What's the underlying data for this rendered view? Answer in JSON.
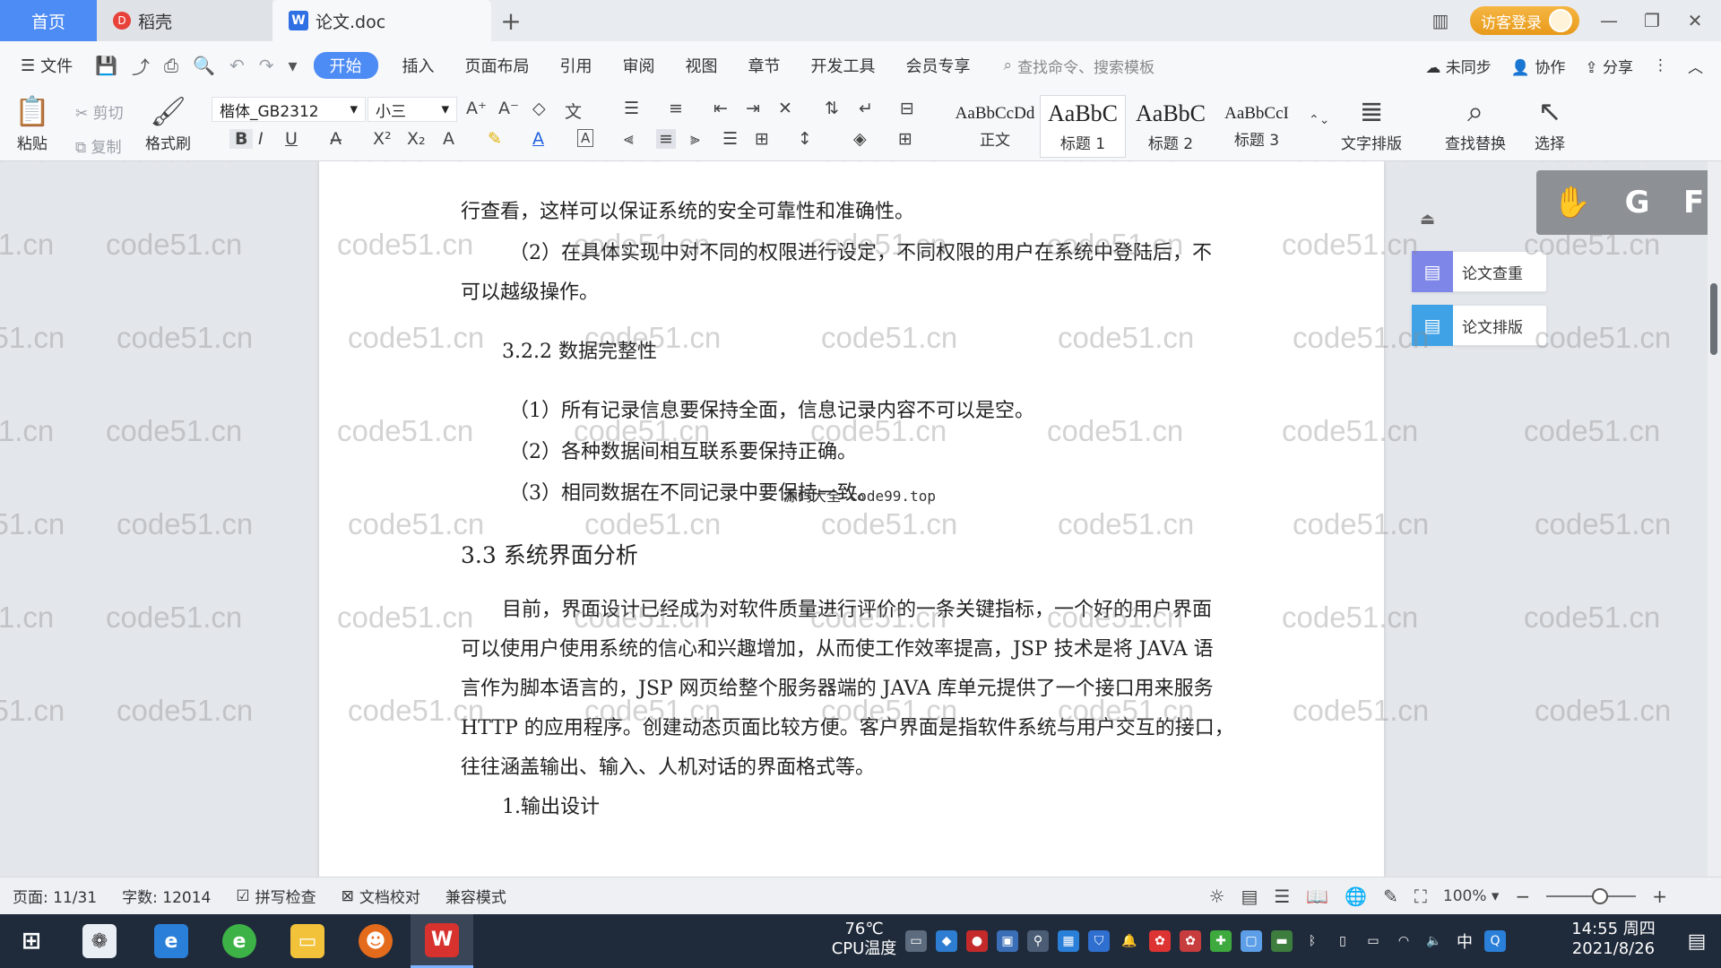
{
  "tabs": {
    "home": "首页",
    "daoke": "稻壳",
    "doc": "论文.doc",
    "plus": "+"
  },
  "titlebar": {
    "visitor_login": "访客登录"
  },
  "menu": {
    "file": "文件",
    "items": [
      "开始",
      "插入",
      "页面布局",
      "引用",
      "审阅",
      "视图",
      "章节",
      "开发工具",
      "会员专享"
    ],
    "search_placeholder": "查找命令、搜索模板",
    "unsynced": "未同步",
    "collaborate": "协作",
    "share": "分享"
  },
  "ribbon": {
    "paste": "粘贴",
    "cut": "剪切",
    "copy": "复制",
    "format_painter": "格式刷",
    "font_name": "楷体_GB2312",
    "font_size": "小三",
    "styles": [
      {
        "sample": "AaBbCcDd",
        "label": "正文"
      },
      {
        "sample": "AaBbC",
        "label": "标题 1"
      },
      {
        "sample": "AaBbC",
        "label": "标题 2"
      },
      {
        "sample": "AaBbCcI",
        "label": "标题 3"
      }
    ],
    "text_layout": "文字排版",
    "find_replace": "查找替换",
    "select": "选择"
  },
  "document": {
    "lines": [
      "行查看，这样可以保证系统的安全可靠性和准确性。",
      "（2）在具体实现中对不同的权限进行设定，不同权限的用户在系统中登陆后，不",
      "可以越级操作。",
      "3.2.2 数据完整性",
      "（1）所有记录信息要保持全面，信息记录内容不可以是空。",
      "（2）各种数据间相互联系要保持正确。",
      "（3）相同数据在不同记录中要保持一致。",
      "3.3 系统界面分析",
      "目前，界面设计已经成为对软件质量进行评价的一条关键指标，一个好的用户界面",
      "可以使用户使用系统的信心和兴趣增加，从而使工作效率提高，JSP 技术是将 JAVA 语",
      "言作为脚本语言的，JSP 网页给整个服务器端的 JAVA 库单元提供了一个接口用来服务",
      "HTTP 的应用程序。创建动态页面比较方便。客户界面是指软件系统与用户交互的接口，",
      "往往涵盖输出、输入、人机对话的界面格式等。",
      "1.输出设计"
    ],
    "overlay": "源码大全 code99.top",
    "watermark": "code51.cn"
  },
  "side_panel": {
    "check": "论文查重",
    "layout": "论文排版",
    "float_letters": [
      "G",
      "F"
    ]
  },
  "status": {
    "page": "页面: 11/31",
    "word_count": "字数: 12014",
    "spell_check": "拼写检查",
    "doc_proofread": "文档校对",
    "compat_mode": "兼容模式",
    "zoom": "100%",
    "zoom_level": 0.6
  },
  "taskbar": {
    "temp": "76℃",
    "cpu_label": "CPU温度",
    "time": "14:55 周四",
    "date": "2021/8/26",
    "ime": "中"
  }
}
